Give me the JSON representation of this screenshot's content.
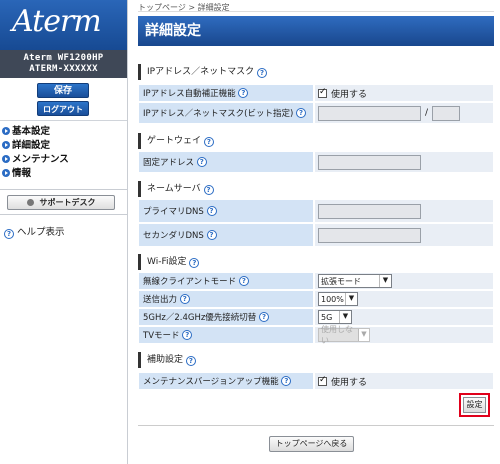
{
  "brand": {
    "logo": "Aterm"
  },
  "device": {
    "model": "Aterm WF1200HP",
    "name": "ATERM-XXXXXX"
  },
  "sidebar": {
    "save_label": "保存",
    "logout_label": "ログアウト",
    "menu": [
      {
        "label": "基本設定"
      },
      {
        "label": "詳細設定"
      },
      {
        "label": "メンテナンス"
      },
      {
        "label": "情報"
      }
    ],
    "support_label": "サポートデスク",
    "help_label": "ヘルプ表示"
  },
  "header": {
    "breadcrumb": "トップページ > 詳細設定",
    "title": "詳細設定"
  },
  "help_glyph": "?",
  "sections": {
    "ip": {
      "title": "IPアドレス／ネットマスク",
      "auto_label": "IPアドレス自動補正機能",
      "auto_value": "使用する",
      "mask_label": "IPアドレス／ネットマスク(ビット指定)",
      "mask_separator": "/",
      "ip_value": "",
      "mask_value": ""
    },
    "gateway": {
      "title": "ゲートウェイ",
      "fixed_label": "固定アドレス",
      "fixed_value": ""
    },
    "dns": {
      "title": "ネームサーバ",
      "primary_label": "プライマリDNS",
      "primary_value": "",
      "secondary_label": "セカンダリDNS",
      "secondary_value": ""
    },
    "wifi": {
      "title": "Wi-Fi設定",
      "client_mode_label": "無線クライアントモード",
      "client_mode_value": "拡張モード",
      "tx_power_label": "送信出力",
      "tx_power_value": "100%",
      "band_label": "5GHz／2.4GHz優先接続切替",
      "band_value": "5G",
      "tv_label": "TVモード",
      "tv_value": "使用しない"
    },
    "aux": {
      "title": "補助設定",
      "maint_label": "メンテナンスバージョンアップ機能",
      "maint_value": "使用する"
    }
  },
  "footer": {
    "set_label": "設定",
    "back_label": "トップページへ戻る"
  }
}
